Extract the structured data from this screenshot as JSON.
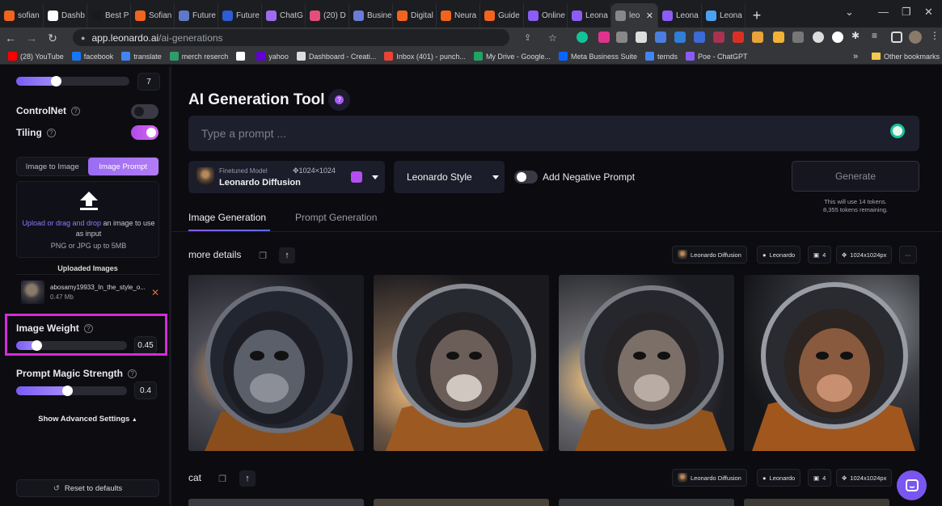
{
  "browser": {
    "tabs": [
      {
        "label": "sofian",
        "color": "#f1641e"
      },
      {
        "label": "Dashb",
        "color": "#ffffff"
      },
      {
        "label": "Best P",
        "color": "#1a1a1a"
      },
      {
        "label": "Sofian",
        "color": "#f1641e"
      },
      {
        "label": "Future",
        "color": "#5f79c9"
      },
      {
        "label": "Future",
        "color": "#2f5bd4"
      },
      {
        "label": "ChatG",
        "color": "#9b6cf2"
      },
      {
        "label": "(20) D",
        "color": "#e54d7b"
      },
      {
        "label": "Busine",
        "color": "#6c7bd8"
      },
      {
        "label": "Digital",
        "color": "#f1641e"
      },
      {
        "label": "Neura",
        "color": "#f1641e"
      },
      {
        "label": "Guide",
        "color": "#f1641e"
      },
      {
        "label": "Online",
        "color": "#8b5cf6"
      },
      {
        "label": "Leona",
        "color": "#8b5cf6"
      },
      {
        "label": "leo",
        "color": "#888888",
        "active": true
      },
      {
        "label": "Leona",
        "color": "#8b5cf6"
      },
      {
        "label": "Leona",
        "color": "#4aa3f0"
      }
    ],
    "url_host": "app.leonardo.ai",
    "url_path": "/ai-generations",
    "bookmarks": [
      {
        "label": "(28) YouTube",
        "color": "#ff0000"
      },
      {
        "label": "facebook",
        "color": "#1877f2"
      },
      {
        "label": "translate",
        "color": "#4285f4"
      },
      {
        "label": "merch reserch",
        "color": "#2d9c6b"
      },
      {
        "label": "",
        "color": "#ffffff"
      },
      {
        "label": "yahoo",
        "color": "#6001d2"
      },
      {
        "label": "Dashboard - Creati...",
        "color": "#dddddd"
      },
      {
        "label": "Inbox (401) - punch...",
        "color": "#ea4335"
      },
      {
        "label": "My Drive - Google...",
        "color": "#1fa463"
      },
      {
        "label": "Meta Business Suite",
        "color": "#0866ff"
      },
      {
        "label": "ternds",
        "color": "#4285f4"
      },
      {
        "label": "Poe - ChatGPT",
        "color": "#8a5cf5"
      }
    ],
    "bookmarks_more": "»",
    "other_bookmarks": "Other bookmarks"
  },
  "sidebar": {
    "top_slider_value": "7",
    "top_slider_level": 0.32,
    "controlnet_label": "ControlNet",
    "tiling_label": "Tiling",
    "seg_image_to_image": "Image to Image",
    "seg_image_prompt": "Image Prompt",
    "upload_link": "Upload or drag and drop",
    "upload_rest": " an image to use as input",
    "upload_sub": "PNG or JPG up to 5MB",
    "uploaded_title": "Uploaded Images",
    "file_name": "abosamy19933_In_the_style_o...",
    "file_size": "0.47 Mb",
    "image_weight_label": "Image Weight",
    "image_weight_value": "0.45",
    "image_weight_level": 0.15,
    "pms_label": "Prompt Magic Strength",
    "pms_value": "0.4",
    "pms_level": 0.43,
    "advanced_label": "Show Advanced Settings",
    "reset_label": "Reset to defaults"
  },
  "main": {
    "title": "AI Generation Tool",
    "prompt_placeholder": "Type a prompt ...",
    "model_small": "Finetuned Model",
    "model_dims": "1024×1024",
    "model_name": "Leonardo Diffusion",
    "style_label": "Leonardo Style",
    "negative_label": "Add Negative Prompt",
    "generate_label": "Generate",
    "tokens_line1": "This will use 14 tokens.",
    "tokens_line2": "8,355 tokens remaining.",
    "tab_image_gen": "Image Generation",
    "tab_prompt_gen": "Prompt Generation",
    "group1_title": "more details",
    "group2_title": "cat",
    "chip_model": "Leonardo Diffusion",
    "chip_style": "Leonardo",
    "chip_count": "4",
    "chip_size": "1024x1024px",
    "chip_more": "···"
  }
}
